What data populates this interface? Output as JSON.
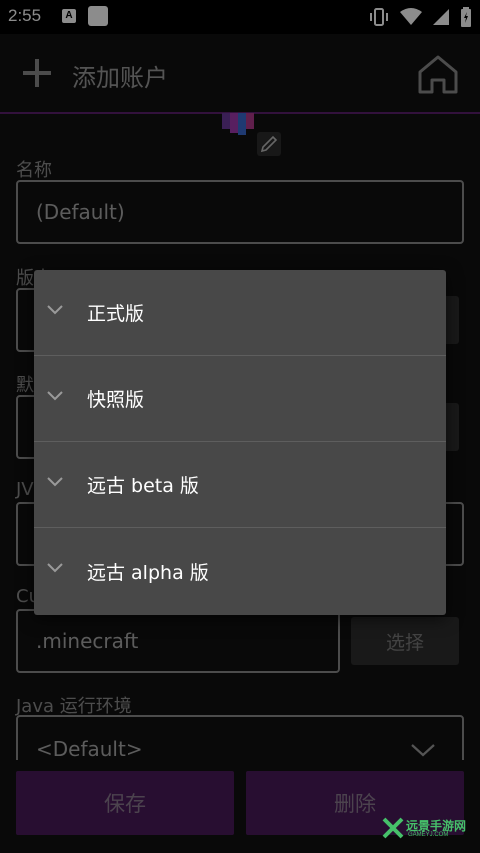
{
  "status_bar": {
    "time": "2:55",
    "notif_letter": "A"
  },
  "toolbar": {
    "title": "添加账户"
  },
  "form": {
    "name_label": "名称",
    "name_value": "(Default)",
    "version_label": "版本",
    "default_label": "默认",
    "jvm_label": "JVM",
    "custom_label": "Cu",
    "gamedir_placeholder": ".minecraft",
    "choose_button": "选择",
    "java_label": "Java 运行环境",
    "java_value": "<Default>"
  },
  "actions": {
    "save": "保存",
    "delete": "删除"
  },
  "popup": {
    "items": [
      {
        "label": "正式版"
      },
      {
        "label": "快照版"
      },
      {
        "label": "远古 beta 版"
      },
      {
        "label": "远古 alpha 版"
      }
    ]
  },
  "watermark": {
    "brand": "远景手游网",
    "site": "GAMEYJ.COM"
  }
}
